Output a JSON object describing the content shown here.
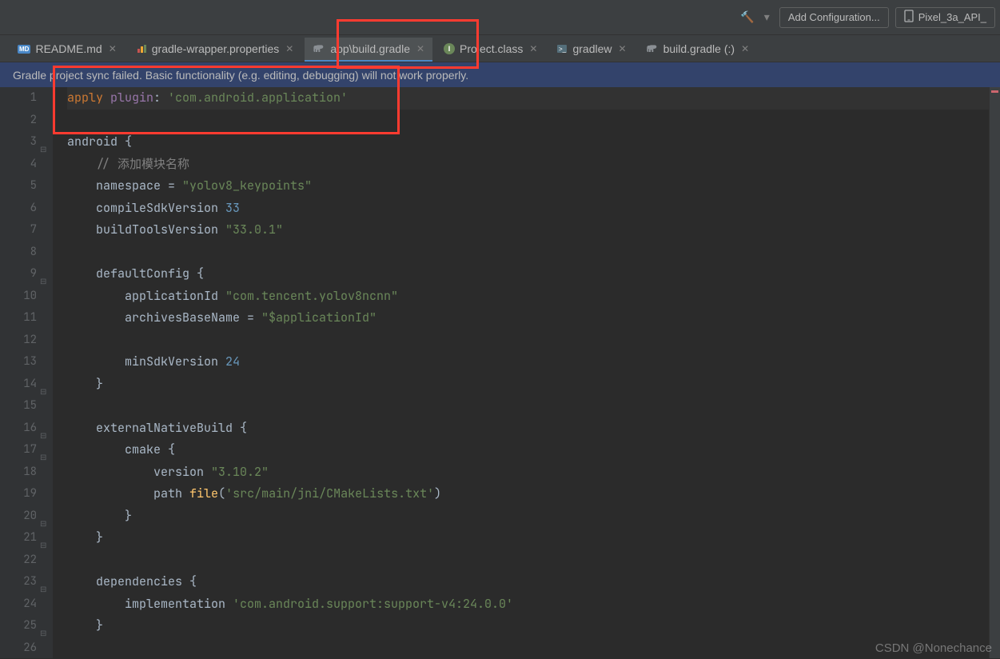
{
  "toolbar": {
    "hammer_icon": "hammer-icon",
    "add_config_label": "Add Configuration...",
    "device_label": "Pixel_3a_API_"
  },
  "tabs": [
    {
      "label": "README.md",
      "icon": "md",
      "active": false
    },
    {
      "label": "gradle-wrapper.properties",
      "icon": "props",
      "active": false
    },
    {
      "label": "app\\build.gradle",
      "icon": "elephant",
      "active": true
    },
    {
      "label": "Project.class",
      "icon": "class",
      "active": false
    },
    {
      "label": "gradlew",
      "icon": "term",
      "active": false
    },
    {
      "label": "build.gradle (:)",
      "icon": "elephant",
      "active": false
    }
  ],
  "warn_bar": "Gradle project sync failed. Basic functionality (e.g. editing, debugging) will not work properly.",
  "code_lines": [
    {
      "n": 1,
      "caret": true,
      "tokens": [
        [
          "kw",
          "apply "
        ],
        [
          "ident",
          "plugin"
        ],
        [
          "txt",
          ": "
        ],
        [
          "str",
          "'com.android.application'"
        ]
      ]
    },
    {
      "n": 2,
      "tokens": [
        [
          "txt",
          ""
        ]
      ]
    },
    {
      "n": 3,
      "tokens": [
        [
          "fn",
          "android "
        ],
        [
          "brace",
          "{"
        ]
      ]
    },
    {
      "n": 4,
      "tokens": [
        [
          "txt",
          "    "
        ],
        [
          "cmt",
          "// 添加模块名称"
        ]
      ]
    },
    {
      "n": 5,
      "tokens": [
        [
          "txt",
          "    "
        ],
        [
          "fn",
          "namespace "
        ],
        [
          "txt",
          "= "
        ],
        [
          "str",
          "\"yolov8_keypoints\""
        ]
      ]
    },
    {
      "n": 6,
      "tokens": [
        [
          "txt",
          "    "
        ],
        [
          "fn",
          "compileSdkVersion "
        ],
        [
          "num",
          "33"
        ]
      ]
    },
    {
      "n": 7,
      "tokens": [
        [
          "txt",
          "    "
        ],
        [
          "fn",
          "buildToolsVersion "
        ],
        [
          "str",
          "\"33.0.1\""
        ]
      ]
    },
    {
      "n": 8,
      "tokens": [
        [
          "txt",
          ""
        ]
      ]
    },
    {
      "n": 9,
      "tokens": [
        [
          "txt",
          "    "
        ],
        [
          "fn",
          "defaultConfig "
        ],
        [
          "brace",
          "{"
        ]
      ]
    },
    {
      "n": 10,
      "tokens": [
        [
          "txt",
          "        "
        ],
        [
          "fn",
          "applicationId "
        ],
        [
          "str",
          "\"com.tencent.yolov8ncnn\""
        ]
      ]
    },
    {
      "n": 11,
      "tokens": [
        [
          "txt",
          "        "
        ],
        [
          "fn",
          "archivesBaseName "
        ],
        [
          "txt",
          "= "
        ],
        [
          "str",
          "\"$applicationId\""
        ]
      ]
    },
    {
      "n": 12,
      "tokens": [
        [
          "txt",
          ""
        ]
      ]
    },
    {
      "n": 13,
      "tokens": [
        [
          "txt",
          "        "
        ],
        [
          "fn",
          "minSdkVersion "
        ],
        [
          "num",
          "24"
        ]
      ]
    },
    {
      "n": 14,
      "tokens": [
        [
          "txt",
          "    "
        ],
        [
          "brace",
          "}"
        ]
      ]
    },
    {
      "n": 15,
      "tokens": [
        [
          "txt",
          ""
        ]
      ]
    },
    {
      "n": 16,
      "tokens": [
        [
          "txt",
          "    "
        ],
        [
          "fn",
          "externalNativeBuild "
        ],
        [
          "brace",
          "{"
        ]
      ]
    },
    {
      "n": 17,
      "tokens": [
        [
          "txt",
          "        "
        ],
        [
          "fn",
          "cmake "
        ],
        [
          "brace",
          "{"
        ]
      ]
    },
    {
      "n": 18,
      "tokens": [
        [
          "txt",
          "            "
        ],
        [
          "fn",
          "version "
        ],
        [
          "str",
          "\"3.10.2\""
        ]
      ]
    },
    {
      "n": 19,
      "tokens": [
        [
          "txt",
          "            "
        ],
        [
          "fn",
          "path "
        ],
        [
          "meth",
          "file"
        ],
        [
          "txt",
          "("
        ],
        [
          "str",
          "'src/main/jni/CMakeLists.txt'"
        ],
        [
          "txt",
          ")"
        ]
      ]
    },
    {
      "n": 20,
      "tokens": [
        [
          "txt",
          "        "
        ],
        [
          "brace",
          "}"
        ]
      ]
    },
    {
      "n": 21,
      "tokens": [
        [
          "txt",
          "    "
        ],
        [
          "brace",
          "}"
        ]
      ]
    },
    {
      "n": 22,
      "tokens": [
        [
          "txt",
          ""
        ]
      ]
    },
    {
      "n": 23,
      "tokens": [
        [
          "txt",
          "    "
        ],
        [
          "fn",
          "dependencies "
        ],
        [
          "brace",
          "{"
        ]
      ]
    },
    {
      "n": 24,
      "tokens": [
        [
          "txt",
          "        "
        ],
        [
          "fn",
          "implementation "
        ],
        [
          "str",
          "'com.android.support:support-v4:24.0.0'"
        ]
      ]
    },
    {
      "n": 25,
      "tokens": [
        [
          "txt",
          "    "
        ],
        [
          "brace",
          "}"
        ]
      ]
    },
    {
      "n": 26,
      "tokens": [
        [
          "txt",
          ""
        ]
      ]
    }
  ],
  "watermark": "CSDN @Nonechance"
}
